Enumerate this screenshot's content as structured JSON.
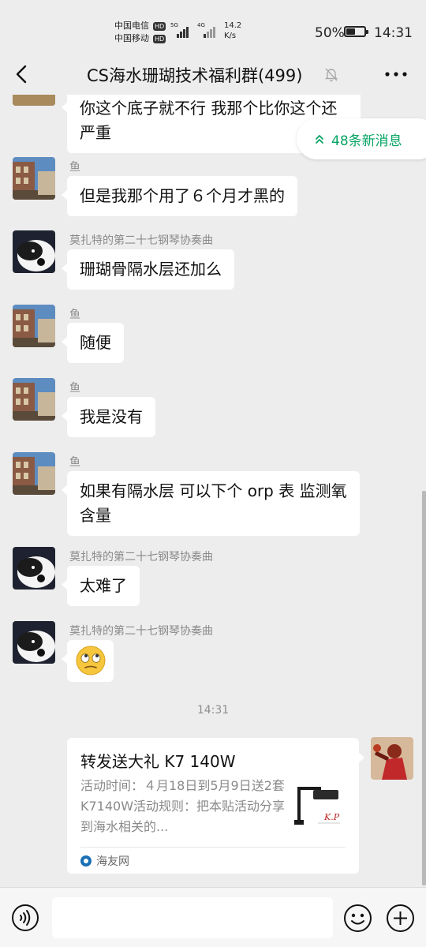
{
  "status_bar": {
    "carrier1": "中国电信",
    "carrier2": "中国移动",
    "hd": "HD",
    "signal1": "5G",
    "signal2": "4G",
    "net_speed_value": "14.2",
    "net_speed_unit": "K/s",
    "battery_percent": "50%",
    "battery_level": 0.5,
    "time": "14:31"
  },
  "header": {
    "title": "CS海水珊瑚技术福利群(499)",
    "back_icon": "chevron-left-icon",
    "mute_icon": "bell-off-icon",
    "more_icon": "more-dots-icon"
  },
  "new_messages": {
    "label": "48条新消息",
    "icon": "double-chevron-up-icon",
    "color": "#07a463"
  },
  "messages": [
    {
      "sender": "",
      "text": "你这个底子就不行 我那个比你这个还严重"
    },
    {
      "sender": "鱼",
      "text": "但是我那个用了６个月才黑的"
    },
    {
      "sender": "莫扎特的第二十七钢琴协奏曲",
      "text": "珊瑚骨隔水层还加么"
    },
    {
      "sender": "鱼",
      "text": "随便"
    },
    {
      "sender": "鱼",
      "text": "我是没有"
    },
    {
      "sender": "鱼",
      "text": "如果有隔水层 可以下个 orp 表 监测氧含量"
    },
    {
      "sender": "莫扎特的第二十七钢琴协奏曲",
      "text": "太难了"
    },
    {
      "sender": "莫扎特的第二十七钢琴协奏曲",
      "text": "",
      "emoji": "rolling-eyes-emoji"
    }
  ],
  "timestamp": "14:31",
  "shared_card": {
    "title": "转发送大礼 K7 140W",
    "description": "活动时间：４月18日到5月9日送2套K7140W活动规则：把本贴活动分享到海水相关的...",
    "thumb_text": "K.P",
    "source": "海友网"
  },
  "input_bar": {
    "placeholder": "",
    "voice_icon": "voice-icon",
    "emoji_icon": "emoji-icon",
    "plus_icon": "plus-icon"
  }
}
